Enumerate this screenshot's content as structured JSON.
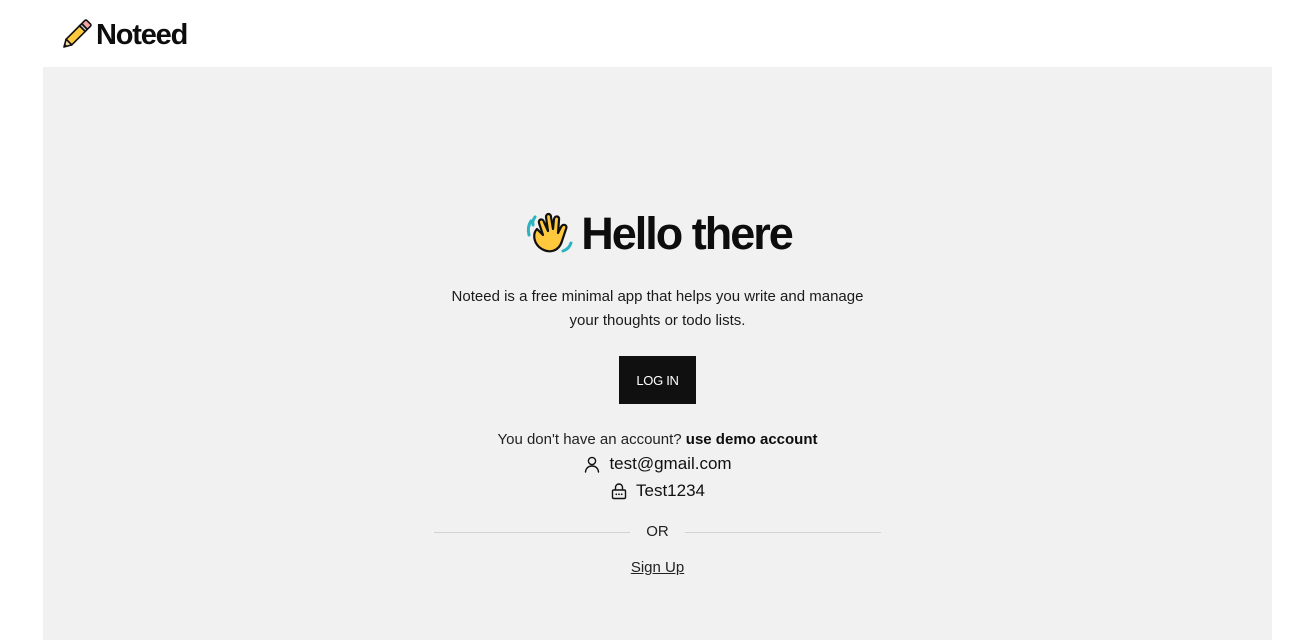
{
  "header": {
    "logo_icon": "pencil-icon",
    "logo_text": "Noteed"
  },
  "hero": {
    "icon": "waving-hand-icon",
    "title": "Hello there",
    "description_line1": "Noteed is a free minimal app that helps you write and manage",
    "description_line2": "your thoughts or todo lists."
  },
  "login": {
    "button_label": "LOG IN"
  },
  "account": {
    "prompt": "You don't have an account?",
    "demo_link": "use demo account",
    "demo_email_icon": "user-icon",
    "demo_email": "test@gmail.com",
    "demo_password_icon": "lock-icon",
    "demo_password": "Test1234"
  },
  "divider": {
    "label": "OR"
  },
  "signup": {
    "link_label": "Sign Up"
  },
  "colors": {
    "page_bg": "#ffffff",
    "panel_bg": "#f1f1f1",
    "button_bg": "#101010",
    "button_text": "#ffffff",
    "text": "#111111"
  }
}
